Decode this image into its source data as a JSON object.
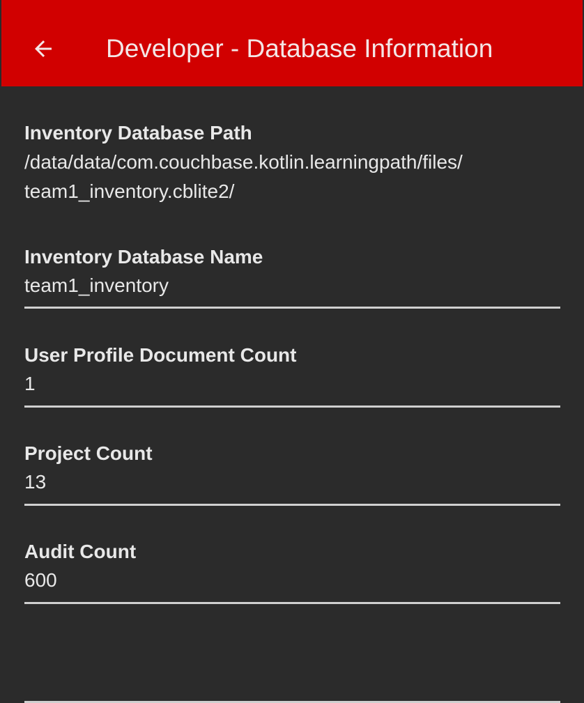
{
  "app_bar": {
    "title": "Developer - Database Information",
    "back_icon": "arrow-back-icon",
    "background_color": "#d10000"
  },
  "items": [
    {
      "label": "Inventory Database Path",
      "value_line1": "/data/data/com.couchbase.kotlin.learningpath/files/",
      "value_line2": "team1_inventory.cblite2/"
    },
    {
      "label": "Inventory Database Name",
      "value": "team1_inventory"
    },
    {
      "label": "User Profile Document Count",
      "value": "1"
    },
    {
      "label": "Project Count",
      "value": "13"
    },
    {
      "label": "Audit Count",
      "value": "600"
    }
  ],
  "colors": {
    "background": "#2b2b2b",
    "text": "#e8e8e8",
    "divider": "#d0d0d0"
  }
}
